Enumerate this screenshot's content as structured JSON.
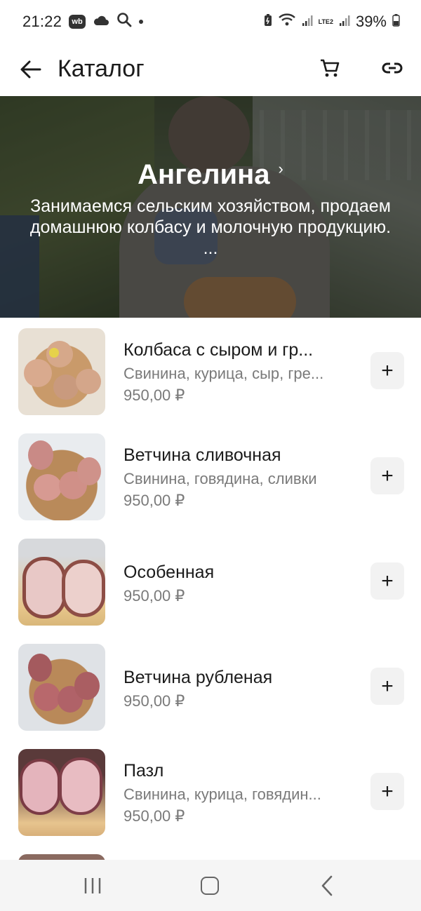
{
  "status_bar": {
    "time": "21:22",
    "wb_badge": "wb",
    "battery": "39%",
    "network_label": "LTE2"
  },
  "app_bar": {
    "title": "Каталог"
  },
  "shop": {
    "name": "Ангелина",
    "description": "Занимаемся сельским хозяйством, продаем домашнюю колбасу и молочную продукцию. ..."
  },
  "products": [
    {
      "name": "Колбаса с сыром и гр...",
      "description": "Свинина, курица, сыр, гре...",
      "price": "950,00 ₽",
      "add_label": "+"
    },
    {
      "name": "Ветчина сливочная",
      "description": "Свинина, говядина, сливки",
      "price": "950,00 ₽",
      "add_label": "+"
    },
    {
      "name": "Особенная",
      "description": "",
      "price": "950,00 ₽",
      "add_label": "+"
    },
    {
      "name": "Ветчина рубленая",
      "description": "",
      "price": "950,00 ₽",
      "add_label": "+"
    },
    {
      "name": "Пазл",
      "description": "Свинина, курица, говядин...",
      "price": "950,00 ₽",
      "add_label": "+"
    }
  ],
  "colors": {
    "add_button_bg": "#f2f2f2",
    "secondary_text": "#7a7a7a",
    "nav_bar_bg": "#f5f5f5"
  }
}
